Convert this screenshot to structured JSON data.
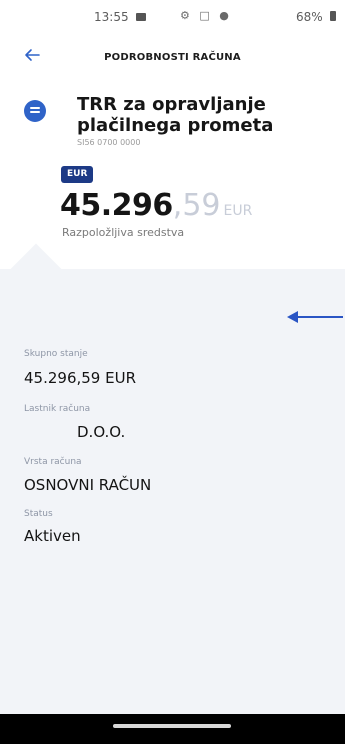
{
  "status_bar": {
    "time": "13:55",
    "icons": "⚙ □ ●",
    "battery_text": "68%"
  },
  "header": {
    "title": "PODROBNOSTI RAČUNA",
    "back_icon": "arrow-left-icon"
  },
  "account": {
    "name": "TRR za opravljanje plačilnega prometa",
    "iban": "SI56 0700 0000",
    "currency_badge": "EUR",
    "balance_integer": "45.296",
    "balance_decimal": ",59",
    "balance_currency": "EUR",
    "balance_caption": "Razpoložljiva sredstva"
  },
  "details": {
    "total_label": "Skupno stanje",
    "total_value": "45.296,59 EUR",
    "owner_label": "Lastnik računa",
    "owner_value": "D.O.O.",
    "type_label": "Vrsta računa",
    "type_value": "OSNOVNI RAČUN",
    "status_label": "Status",
    "status_value": "Aktiven"
  },
  "colors": {
    "accent": "#2f63c8",
    "badge": "#1d3a86",
    "panel_bg": "#f2f4f8"
  }
}
